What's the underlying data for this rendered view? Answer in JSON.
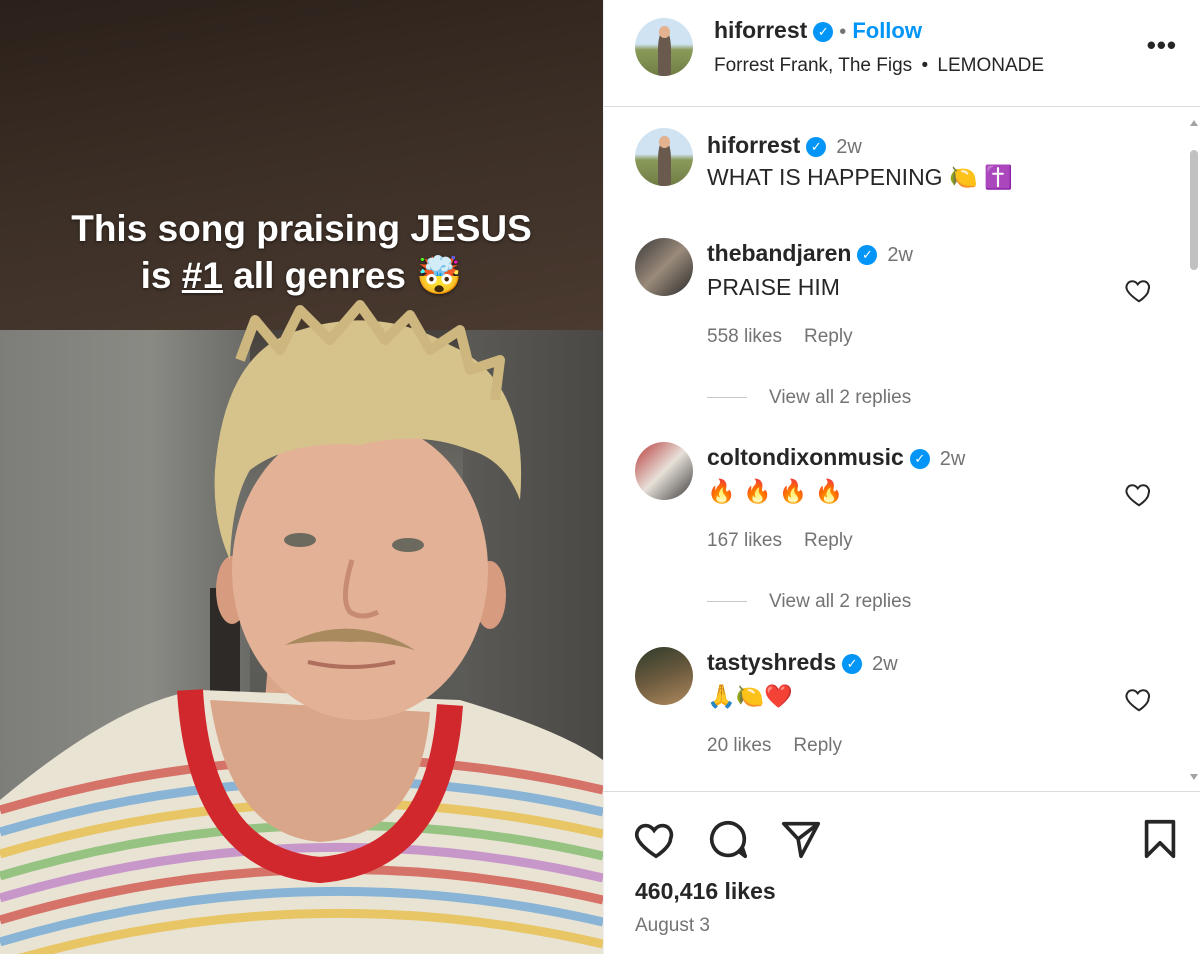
{
  "media": {
    "overlay_line1": "This song praising JESUS",
    "overlay_line2_pre": "is ",
    "overlay_line2_u": "#1",
    "overlay_line2_post": " all genres",
    "overlay_emoji": "🤯"
  },
  "header": {
    "username": "hiforrest",
    "follow_label": "Follow",
    "separator": "•",
    "subtitle_artists": "Forrest Frank, The Figs",
    "subtitle_song": "LEMONADE",
    "more_label": "•••"
  },
  "comments": [
    {
      "username": "hiforrest",
      "time": "2w",
      "text": "WHAT IS HAPPENING 🍋 ✝️"
    },
    {
      "username": "thebandjaren",
      "time": "2w",
      "text": "PRAISE HIM",
      "likes": "558 likes",
      "reply": "Reply",
      "view_replies": "View all 2 replies"
    },
    {
      "username": "coltondixonmusic",
      "time": "2w",
      "text": "🔥 🔥 🔥 🔥",
      "likes": "167 likes",
      "reply": "Reply",
      "view_replies": "View all 2 replies"
    },
    {
      "username": "tastyshreds",
      "time": "2w",
      "text": "🙏🍋❤️",
      "likes": "20 likes",
      "reply": "Reply"
    }
  ],
  "footer": {
    "likes": "460,416 likes",
    "date": "August 3"
  },
  "icons": {
    "like": "heart-icon",
    "comment": "comment-icon",
    "share": "share-icon",
    "save": "bookmark-icon",
    "verified": "verified-badge-icon"
  },
  "colors": {
    "link_blue": "#0095f6",
    "verified_blue": "#0095f6",
    "secondary_text": "#737373"
  }
}
